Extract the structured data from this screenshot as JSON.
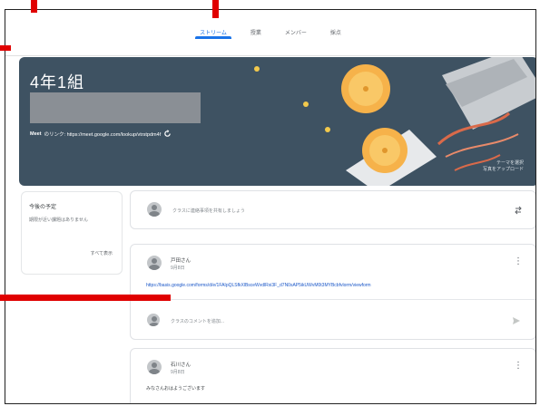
{
  "tabs": [
    {
      "label": "ストリーム",
      "active": true
    },
    {
      "label": "授業",
      "active": false
    },
    {
      "label": "メンバー",
      "active": false
    },
    {
      "label": "採点",
      "active": false
    }
  ],
  "banner": {
    "class_name": "4年1組",
    "meet_label": "Meet",
    "meet_text": "のリンク: https://meet.google.com/lookup/vtrstpdm4f",
    "select_theme": "テーマを選択",
    "upload_photo": "写真をアップロード"
  },
  "upcoming": {
    "heading": "今後の予定",
    "text": "期限が近い課題はありません",
    "view_all": "すべて表示"
  },
  "composer": {
    "placeholder": "クラスに連絡事項を共有しましょう"
  },
  "post1": {
    "author": "戸田さん",
    "date": "9月8日",
    "link": "https://basis.google.com/forms/d/e/1FAIpQLSfkXlBsceWvdlRxi3F_d7N0sAP5ikUWvM0t3MYBcbfvlorm/viewform",
    "comment_placeholder": "クラスのコメントを追加..."
  },
  "post2": {
    "author": "石川さん",
    "date": "9月8日",
    "text": "みなさんおはようございます"
  },
  "colors": {
    "banner": "#3e5262",
    "accent": "#1a73e8",
    "marker": "#e00000"
  }
}
